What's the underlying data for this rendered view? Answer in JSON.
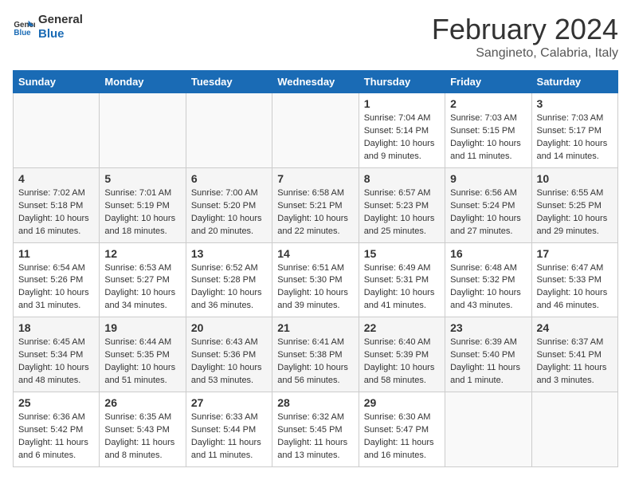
{
  "header": {
    "logo_line1": "General",
    "logo_line2": "Blue",
    "month_title": "February 2024",
    "subtitle": "Sangineto, Calabria, Italy"
  },
  "days_of_week": [
    "Sunday",
    "Monday",
    "Tuesday",
    "Wednesday",
    "Thursday",
    "Friday",
    "Saturday"
  ],
  "weeks": [
    [
      {
        "day": "",
        "content": ""
      },
      {
        "day": "",
        "content": ""
      },
      {
        "day": "",
        "content": ""
      },
      {
        "day": "",
        "content": ""
      },
      {
        "day": "1",
        "content": "Sunrise: 7:04 AM\nSunset: 5:14 PM\nDaylight: 10 hours\nand 9 minutes."
      },
      {
        "day": "2",
        "content": "Sunrise: 7:03 AM\nSunset: 5:15 PM\nDaylight: 10 hours\nand 11 minutes."
      },
      {
        "day": "3",
        "content": "Sunrise: 7:03 AM\nSunset: 5:17 PM\nDaylight: 10 hours\nand 14 minutes."
      }
    ],
    [
      {
        "day": "4",
        "content": "Sunrise: 7:02 AM\nSunset: 5:18 PM\nDaylight: 10 hours\nand 16 minutes."
      },
      {
        "day": "5",
        "content": "Sunrise: 7:01 AM\nSunset: 5:19 PM\nDaylight: 10 hours\nand 18 minutes."
      },
      {
        "day": "6",
        "content": "Sunrise: 7:00 AM\nSunset: 5:20 PM\nDaylight: 10 hours\nand 20 minutes."
      },
      {
        "day": "7",
        "content": "Sunrise: 6:58 AM\nSunset: 5:21 PM\nDaylight: 10 hours\nand 22 minutes."
      },
      {
        "day": "8",
        "content": "Sunrise: 6:57 AM\nSunset: 5:23 PM\nDaylight: 10 hours\nand 25 minutes."
      },
      {
        "day": "9",
        "content": "Sunrise: 6:56 AM\nSunset: 5:24 PM\nDaylight: 10 hours\nand 27 minutes."
      },
      {
        "day": "10",
        "content": "Sunrise: 6:55 AM\nSunset: 5:25 PM\nDaylight: 10 hours\nand 29 minutes."
      }
    ],
    [
      {
        "day": "11",
        "content": "Sunrise: 6:54 AM\nSunset: 5:26 PM\nDaylight: 10 hours\nand 31 minutes."
      },
      {
        "day": "12",
        "content": "Sunrise: 6:53 AM\nSunset: 5:27 PM\nDaylight: 10 hours\nand 34 minutes."
      },
      {
        "day": "13",
        "content": "Sunrise: 6:52 AM\nSunset: 5:28 PM\nDaylight: 10 hours\nand 36 minutes."
      },
      {
        "day": "14",
        "content": "Sunrise: 6:51 AM\nSunset: 5:30 PM\nDaylight: 10 hours\nand 39 minutes."
      },
      {
        "day": "15",
        "content": "Sunrise: 6:49 AM\nSunset: 5:31 PM\nDaylight: 10 hours\nand 41 minutes."
      },
      {
        "day": "16",
        "content": "Sunrise: 6:48 AM\nSunset: 5:32 PM\nDaylight: 10 hours\nand 43 minutes."
      },
      {
        "day": "17",
        "content": "Sunrise: 6:47 AM\nSunset: 5:33 PM\nDaylight: 10 hours\nand 46 minutes."
      }
    ],
    [
      {
        "day": "18",
        "content": "Sunrise: 6:45 AM\nSunset: 5:34 PM\nDaylight: 10 hours\nand 48 minutes."
      },
      {
        "day": "19",
        "content": "Sunrise: 6:44 AM\nSunset: 5:35 PM\nDaylight: 10 hours\nand 51 minutes."
      },
      {
        "day": "20",
        "content": "Sunrise: 6:43 AM\nSunset: 5:36 PM\nDaylight: 10 hours\nand 53 minutes."
      },
      {
        "day": "21",
        "content": "Sunrise: 6:41 AM\nSunset: 5:38 PM\nDaylight: 10 hours\nand 56 minutes."
      },
      {
        "day": "22",
        "content": "Sunrise: 6:40 AM\nSunset: 5:39 PM\nDaylight: 10 hours\nand 58 minutes."
      },
      {
        "day": "23",
        "content": "Sunrise: 6:39 AM\nSunset: 5:40 PM\nDaylight: 11 hours\nand 1 minute."
      },
      {
        "day": "24",
        "content": "Sunrise: 6:37 AM\nSunset: 5:41 PM\nDaylight: 11 hours\nand 3 minutes."
      }
    ],
    [
      {
        "day": "25",
        "content": "Sunrise: 6:36 AM\nSunset: 5:42 PM\nDaylight: 11 hours\nand 6 minutes."
      },
      {
        "day": "26",
        "content": "Sunrise: 6:35 AM\nSunset: 5:43 PM\nDaylight: 11 hours\nand 8 minutes."
      },
      {
        "day": "27",
        "content": "Sunrise: 6:33 AM\nSunset: 5:44 PM\nDaylight: 11 hours\nand 11 minutes."
      },
      {
        "day": "28",
        "content": "Sunrise: 6:32 AM\nSunset: 5:45 PM\nDaylight: 11 hours\nand 13 minutes."
      },
      {
        "day": "29",
        "content": "Sunrise: 6:30 AM\nSunset: 5:47 PM\nDaylight: 11 hours\nand 16 minutes."
      },
      {
        "day": "",
        "content": ""
      },
      {
        "day": "",
        "content": ""
      }
    ]
  ]
}
